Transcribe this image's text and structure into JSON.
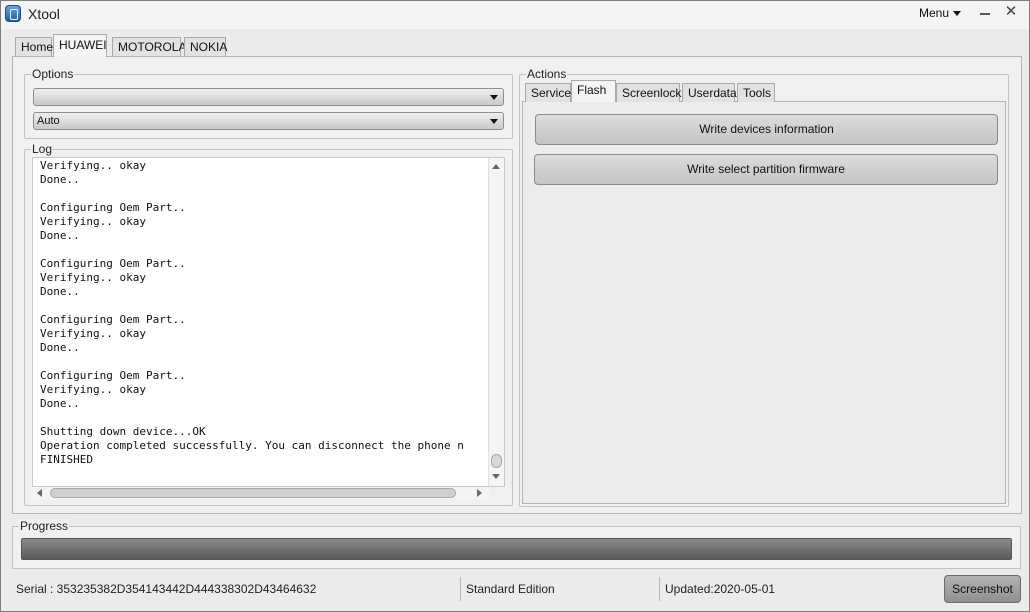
{
  "window": {
    "title": "Xtool",
    "menu_label": "Menu",
    "minimize_glyph": "—",
    "close_glyph": "✕"
  },
  "top_tabs": [
    {
      "label": "Home",
      "active": false
    },
    {
      "label": "HUAWEI",
      "active": true
    },
    {
      "label": "MOTOROLA",
      "active": false
    },
    {
      "label": "NOKIA",
      "active": false
    }
  ],
  "options": {
    "title": "Options",
    "combo1": {
      "value": ""
    },
    "combo2": {
      "value": "Auto"
    }
  },
  "log": {
    "title": "Log",
    "text": "Verifying.. okay\nDone..\n\nConfiguring Oem Part..\nVerifying.. okay\nDone..\n\nConfiguring Oem Part..\nVerifying.. okay\nDone..\n\nConfiguring Oem Part..\nVerifying.. okay\nDone..\n\nConfiguring Oem Part..\nVerifying.. okay\nDone..\n\nShutting down device...OK\nOperation completed successfully. You can disconnect the phone n\nFINISHED"
  },
  "actions": {
    "title": "Actions",
    "tabs": [
      {
        "label": "Service",
        "active": false
      },
      {
        "label": "Flash",
        "active": true
      },
      {
        "label": "Screenlock",
        "active": false
      },
      {
        "label": "Userdata",
        "active": false
      },
      {
        "label": "Tools",
        "active": false
      }
    ],
    "buttons": [
      {
        "label": "Write devices information"
      },
      {
        "label": "Write select partition firmware"
      }
    ]
  },
  "progress": {
    "title": "Progress",
    "value_fraction": 1.0
  },
  "status": {
    "serial": "Serial : 353235382D354143442D444338302D43464632",
    "edition": "Standard Edition",
    "updated": "Updated:2020-05-01",
    "screenshot_label": "Screenshot"
  },
  "icons": {
    "app": "app-logo-icon",
    "menu": "chevron-down-icon",
    "minimize": "minimize-icon",
    "close": "close-icon"
  }
}
